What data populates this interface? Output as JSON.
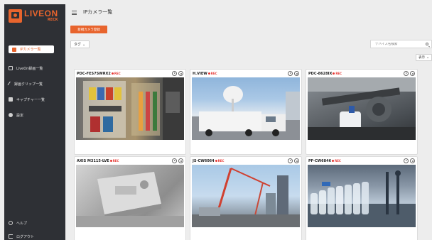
{
  "app": {
    "logo_name": "LIVEON",
    "logo_sub": "RECK"
  },
  "sidebar": {
    "items": [
      {
        "label": "IPカメラ一覧",
        "icon": "camera-icon"
      },
      {
        "label": "LiveOn録画一覧",
        "icon": "video-icon"
      },
      {
        "label": "録画クリップ一覧",
        "icon": "clip-icon"
      },
      {
        "label": "キャプチャー一覧",
        "icon": "snapshot-icon"
      },
      {
        "label": "設定",
        "icon": "gear-icon"
      }
    ],
    "bottom": [
      {
        "label": "ヘルプ",
        "icon": "help-icon"
      },
      {
        "label": "ログアウト",
        "icon": "logout-icon"
      }
    ]
  },
  "header": {
    "title": "IPカメラ一覧"
  },
  "toolbar": {
    "add_button": "新規カメラ登録",
    "tag_select": "タグ",
    "search_placeholder": "デバイス名検索",
    "display_select": "表示"
  },
  "cameras": [
    {
      "name": "PDC-FES7SWRX2",
      "status": "REC"
    },
    {
      "name": "H.VIEW",
      "status": "REC"
    },
    {
      "name": "PDC-8628IX",
      "status": "REC"
    },
    {
      "name": "AXIS M3115-LVE",
      "status": "REC"
    },
    {
      "name": "JS-CW6064",
      "status": "REC"
    },
    {
      "name": "PF-CW6846",
      "status": "REC"
    }
  ],
  "colors": {
    "accent": "#e8642d",
    "sidebar_bg": "#2e3035",
    "rec": "#e53935"
  }
}
